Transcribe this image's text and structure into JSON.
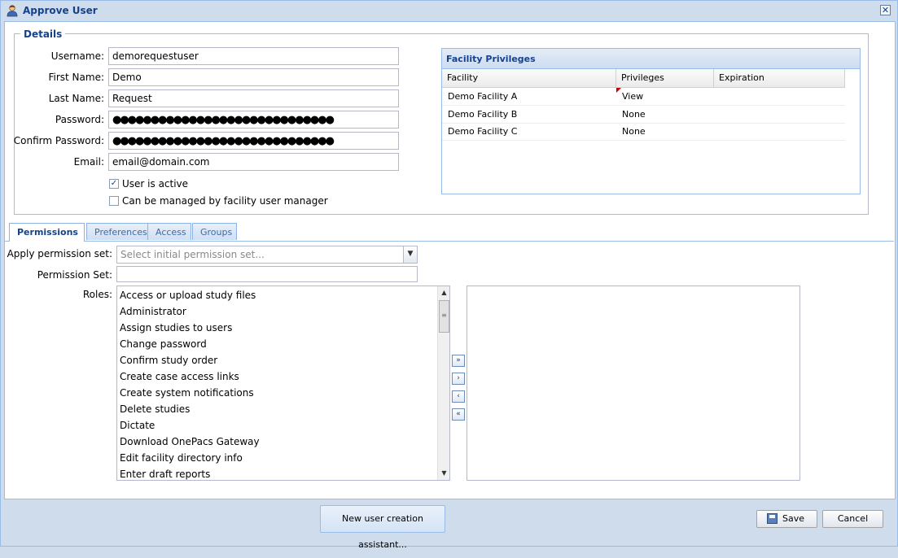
{
  "window": {
    "title": "Approve User",
    "close_symbol": "✕"
  },
  "details": {
    "legend": "Details",
    "labels": {
      "username": "Username:",
      "first_name": "First Name:",
      "last_name": "Last Name:",
      "password": "Password:",
      "confirm_password": "Confirm Password:",
      "email": "Email:"
    },
    "values": {
      "username": "demorequestuser",
      "first_name": "Demo",
      "last_name": "Request",
      "password": "●●●●●●●●●●●●●●●●●●●●●●●●●●●●●",
      "confirm_password": "●●●●●●●●●●●●●●●●●●●●●●●●●●●●●",
      "email": "email@domain.com"
    },
    "checkboxes": {
      "active_label": "User is active",
      "active_checked": "✓",
      "managed_label": "Can be managed by facility user manager",
      "managed_checked": ""
    }
  },
  "facility_privileges": {
    "title": "Facility Privileges",
    "columns": [
      "Facility",
      "Privileges",
      "Expiration"
    ],
    "rows": [
      {
        "facility": "Demo Facility A",
        "privileges": "View",
        "expiration": ""
      },
      {
        "facility": "Demo Facility B",
        "privileges": "None",
        "expiration": ""
      },
      {
        "facility": "Demo Facility C",
        "privileges": "None",
        "expiration": ""
      }
    ]
  },
  "tabs": [
    "Permissions",
    "Preferences",
    "Access",
    "Groups"
  ],
  "permissions": {
    "apply_label": "Apply permission set:",
    "apply_placeholder": "Select initial permission set...",
    "set_label": "Permission Set:",
    "set_value": "",
    "roles_label": "Roles:",
    "roles": [
      "Access or upload study files",
      "Administrator",
      "Assign studies to users",
      "Change password",
      "Confirm study order",
      "Create case access links",
      "Create system notifications",
      "Delete studies",
      "Dictate",
      "Download OnePacs Gateway",
      "Edit facility directory info",
      "Enter draft reports"
    ],
    "move_buttons": [
      "»",
      "›",
      "‹",
      "«"
    ]
  },
  "footer": {
    "assistant_label": "New user creation assistant...",
    "save_label": "Save",
    "cancel_label": "Cancel"
  }
}
